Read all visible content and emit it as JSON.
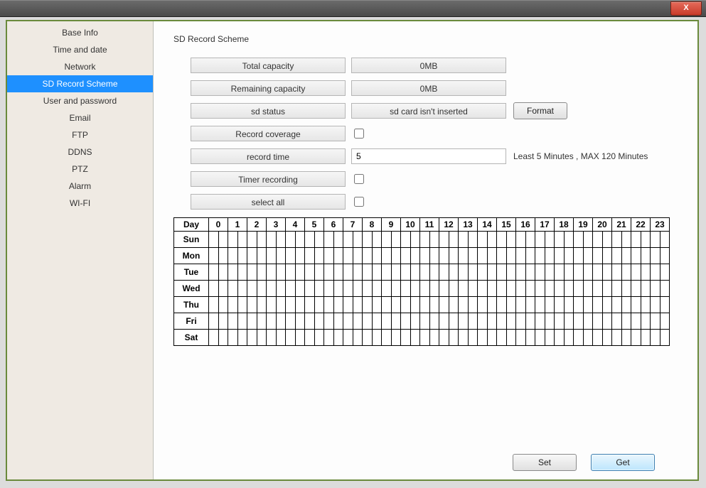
{
  "titlebar": {
    "close_label": "X"
  },
  "sidebar": {
    "items": [
      {
        "label": "Base Info",
        "selected": false
      },
      {
        "label": "Time and date",
        "selected": false
      },
      {
        "label": "Network",
        "selected": false
      },
      {
        "label": "SD Record Scheme",
        "selected": true
      },
      {
        "label": "User and password",
        "selected": false
      },
      {
        "label": "Email",
        "selected": false
      },
      {
        "label": "FTP",
        "selected": false
      },
      {
        "label": "DDNS",
        "selected": false
      },
      {
        "label": "PTZ",
        "selected": false
      },
      {
        "label": "Alarm",
        "selected": false
      },
      {
        "label": "WI-FI",
        "selected": false
      }
    ]
  },
  "main": {
    "title": "SD Record Scheme",
    "rows": {
      "total_capacity_label": "Total capacity",
      "total_capacity_value": "0MB",
      "remaining_capacity_label": "Remaining capacity",
      "remaining_capacity_value": "0MB",
      "sd_status_label": "sd status",
      "sd_status_value": "sd card isn't inserted",
      "format_button": "Format",
      "record_coverage_label": "Record coverage",
      "record_coverage_checked": false,
      "record_time_label": "record time",
      "record_time_value": "5",
      "record_time_hint": "Least 5 Minutes , MAX 120 Minutes",
      "timer_recording_label": "Timer recording",
      "timer_recording_checked": false,
      "select_all_label": "select all",
      "select_all_checked": false
    },
    "schedule": {
      "header_day": "Day",
      "hours": [
        "0",
        "1",
        "2",
        "3",
        "4",
        "5",
        "6",
        "7",
        "8",
        "9",
        "10",
        "11",
        "12",
        "13",
        "14",
        "15",
        "16",
        "17",
        "18",
        "19",
        "20",
        "21",
        "22",
        "23"
      ],
      "days": [
        "Sun",
        "Mon",
        "Tue",
        "Wed",
        "Thu",
        "Fri",
        "Sat"
      ]
    },
    "buttons": {
      "set": "Set",
      "get": "Get"
    }
  }
}
